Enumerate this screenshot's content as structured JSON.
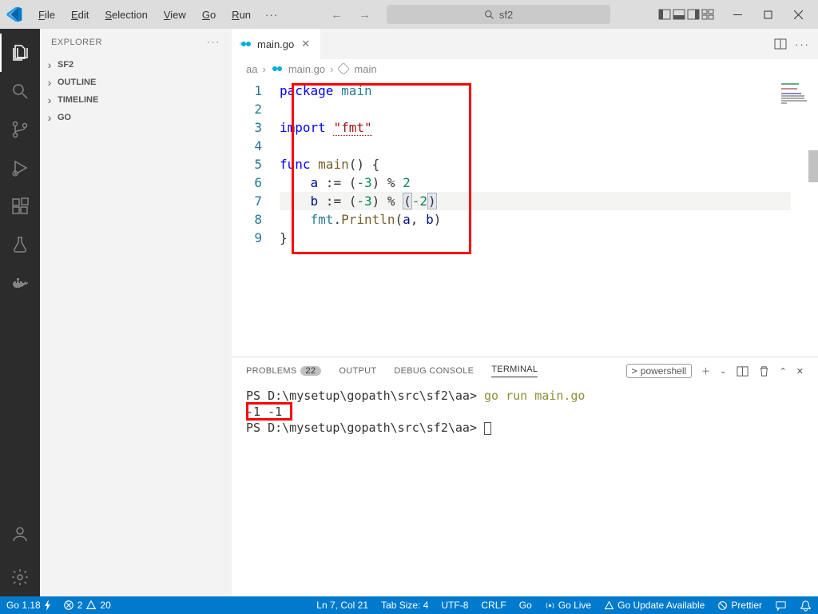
{
  "menu": {
    "file": "File",
    "edit": "Edit",
    "selection": "Selection",
    "view": "View",
    "go": "Go",
    "run": "Run"
  },
  "search_placeholder": "sf2",
  "sidebar": {
    "title": "EXPLORER",
    "sections": [
      "SF2",
      "OUTLINE",
      "TIMELINE",
      "GO"
    ]
  },
  "tab": {
    "file": "main.go"
  },
  "breadcrumb": {
    "a": "aa",
    "b": "main.go",
    "c": "main"
  },
  "code": {
    "l1": "package main",
    "l3": "import \"fmt\"",
    "l5": "func main() {",
    "l6": "    a := (-3) % 2",
    "l7": "    b := (-3) % (-2)",
    "l8": "    fmt.Println(a, b)",
    "l9": "}"
  },
  "panel": {
    "problems": "PROBLEMS",
    "problems_n": "22",
    "output": "OUTPUT",
    "debug": "DEBUG CONSOLE",
    "terminal": "TERMINAL",
    "shell": "powershell"
  },
  "terminal": {
    "prompt1": "PS D:\\mysetup\\gopath\\src\\sf2\\aa> ",
    "cmd1": "go run main.go",
    "out": "-1 -1",
    "prompt2": "PS D:\\mysetup\\gopath\\src\\sf2\\aa> "
  },
  "status": {
    "go": "Go 1.18",
    "err": "2",
    "warn": "20",
    "pos": "Ln 7, Col 21",
    "tab": "Tab Size: 4",
    "enc": "UTF-8",
    "eol": "CRLF",
    "lang": "Go",
    "live": "Go Live",
    "upd": "Go Update Available",
    "pret": "Prettier"
  }
}
